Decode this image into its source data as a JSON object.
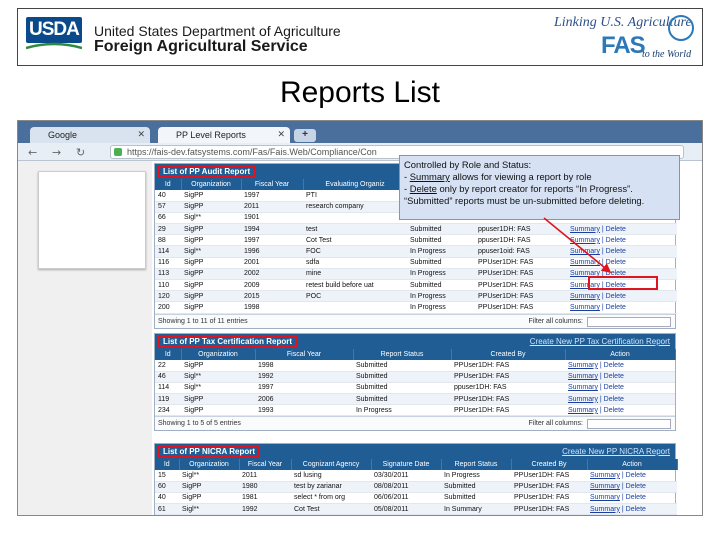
{
  "header": {
    "usda_logo": "USDA",
    "line1": "United States Department of Agriculture",
    "line2": "Foreign Agricultural Service",
    "fas_tagline": "Linking U.S. Agriculture",
    "fas_logo": "FAS",
    "fas_sub": "to the World"
  },
  "slide_title": "Reports List",
  "browser": {
    "tabs": [
      {
        "label": "Google"
      },
      {
        "label": "PP Level Reports"
      }
    ],
    "new_tab_label": "+",
    "url": "https://fais-dev.fatsystems.com/Fas/Fais.Web/Compliance/Con"
  },
  "callout": {
    "line1": "Controlled by Role and Status:",
    "line2_prefix": "- ",
    "line2_link": "Summary",
    "line2_rest": " allows for viewing a report by role",
    "line3_prefix": "- ",
    "line3_link": "Delete",
    "line3_rest": " only by report creator for reports “In Progress”.",
    "line4": "“Submitted” reports must be un-submitted before deleting."
  },
  "audit": {
    "title": "List of PP Audit Report",
    "columns": [
      "Id",
      "Organization",
      "Fiscal Year",
      "Evaluating Organiz"
    ],
    "rows": [
      {
        "id": "40",
        "org": "SigPP",
        "fy": "1997",
        "eval": "PTI",
        "status": "",
        "by": "",
        "act": ""
      },
      {
        "id": "57",
        "org": "SigPP",
        "fy": "2011",
        "eval": "research company",
        "status": "",
        "by": "",
        "act": ""
      },
      {
        "id": "66",
        "org": "Sigl**",
        "fy": "1901",
        "eval": "",
        "status": "",
        "by": "",
        "act": ""
      },
      {
        "id": "29",
        "org": "SigPP",
        "fy": "1994",
        "eval": "test",
        "status": "Submitted",
        "by": "ppuser1DH: FAS",
        "act": "Summary | Delete"
      },
      {
        "id": "88",
        "org": "SigPP",
        "fy": "1997",
        "eval": "Cot Test",
        "status": "Submitted",
        "by": "ppuser1DH: FAS",
        "act": "Summary | Delete"
      },
      {
        "id": "114",
        "org": "Sigl**",
        "fy": "1996",
        "eval": "FOC",
        "status": "In Progress",
        "by": "ppuser1oid: FAS",
        "act": "Summary | Delete"
      },
      {
        "id": "116",
        "org": "SigPP",
        "fy": "2001",
        "eval": "sdfa",
        "status": "Submitted",
        "by": "PPUser1DH: FAS",
        "act": "Summary | Delete"
      },
      {
        "id": "113",
        "org": "SigPP",
        "fy": "2002",
        "eval": "mine",
        "status": "In Progress",
        "by": "PPUser1DH: FAS",
        "act": "Summary | Delete"
      },
      {
        "id": "110",
        "org": "SigPP",
        "fy": "2009",
        "eval": "retest build before uat",
        "status": "Submitted",
        "by": "PPUser1DH: FAS",
        "act": "Summary | Delete"
      },
      {
        "id": "120",
        "org": "SigPP",
        "fy": "2015",
        "eval": "POC",
        "status": "In Progress",
        "by": "PPUser1DH: FAS",
        "act": "Summary | Delete"
      },
      {
        "id": "200",
        "org": "SigPP",
        "fy": "1998",
        "eval": "",
        "status": "In Progress",
        "by": "PPUser1DH: FAS",
        "act": "Summary | Delete"
      }
    ],
    "footer": "Showing 1 to 11 of 11 entries",
    "filter_label": "Filter all columns:"
  },
  "tax": {
    "title": "List of PP Tax Certification Report",
    "create_link": "Create New PP Tax Certification Report",
    "columns": [
      "Id",
      "Organization",
      "Fiscal Year",
      "Report Status",
      "Created By",
      "Action"
    ],
    "rows": [
      {
        "id": "22",
        "org": "SigPP",
        "fy": "1998",
        "status": "Submitted",
        "by": "PPUser1DH: FAS",
        "act": "Summary | Delete"
      },
      {
        "id": "46",
        "org": "Sigl**",
        "fy": "1992",
        "status": "Submitted",
        "by": "PPUser1DH: FAS",
        "act": "Summary | Delete"
      },
      {
        "id": "114",
        "org": "Sigl**",
        "fy": "1997",
        "status": "Submitted",
        "by": "ppuser1DH: FAS",
        "act": "Summary | Delete"
      },
      {
        "id": "119",
        "org": "SigPP",
        "fy": "2006",
        "status": "Submitted",
        "by": "PPUser1DH: FAS",
        "act": "Summary | Delete"
      },
      {
        "id": "234",
        "org": "SigPP",
        "fy": "1993",
        "status": "In Progress",
        "by": "PPUser1DH: FAS",
        "act": "Summary | Delete"
      }
    ],
    "footer": "Showing 1 to 5 of 5 entries",
    "filter_label": "Filter all columns:"
  },
  "nicra": {
    "title": "List of PP NICRA Report",
    "create_link": "Create New PP NICRA Report",
    "columns": [
      "Id",
      "Organization",
      "Fiscal Year",
      "Cognizant Agency",
      "Signature Date",
      "Report Status",
      "Created By",
      "Action"
    ],
    "rows": [
      {
        "id": "15",
        "org": "Sigl**",
        "fy": "2011",
        "agency": "sd lusing",
        "date": "03/30/2011",
        "status": "In Progress",
        "by": "PPUser1DH: FAS",
        "act": "Summary | Delete"
      },
      {
        "id": "60",
        "org": "SigPP",
        "fy": "1980",
        "agency": "test by zarianar",
        "date": "08/08/2011",
        "status": "Submitted",
        "by": "PPUser1DH: FAS",
        "act": "Summary | Delete"
      },
      {
        "id": "40",
        "org": "SigPP",
        "fy": "1981",
        "agency": "select * from org",
        "date": "06/06/2011",
        "status": "Submitted",
        "by": "PPUser1DH: FAS",
        "act": "Summary | Delete"
      },
      {
        "id": "61",
        "org": "Sigl**",
        "fy": "1992",
        "agency": "Cot Test",
        "date": "05/08/2011",
        "status": "In Summary",
        "by": "PPUser1DH: FAS",
        "act": "Summary | Delete"
      }
    ]
  }
}
